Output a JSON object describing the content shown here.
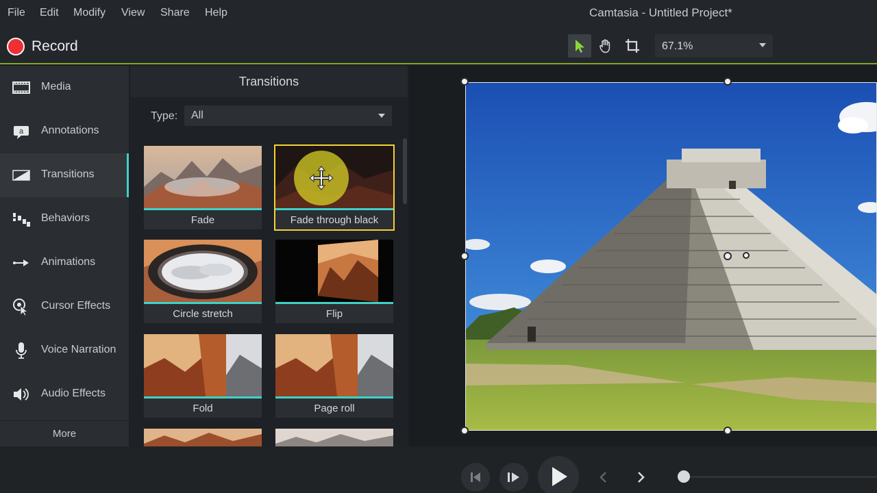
{
  "menu": [
    "File",
    "Edit",
    "Modify",
    "View",
    "Share",
    "Help"
  ],
  "window_title": "Camtasia - Untitled Project*",
  "toolbar": {
    "record_label": "Record",
    "zoom_value": "67.1%",
    "tools": [
      "select-tool",
      "pan-tool",
      "crop-tool"
    ]
  },
  "sidebar": {
    "items": [
      {
        "label": "Media",
        "icon": "film-icon"
      },
      {
        "label": "Annotations",
        "icon": "callout-icon"
      },
      {
        "label": "Transitions",
        "icon": "transition-icon",
        "active": true
      },
      {
        "label": "Behaviors",
        "icon": "behaviors-icon"
      },
      {
        "label": "Animations",
        "icon": "animation-arrow-icon"
      },
      {
        "label": "Cursor Effects",
        "icon": "cursor-effects-icon"
      },
      {
        "label": "Voice Narration",
        "icon": "microphone-icon"
      },
      {
        "label": "Audio Effects",
        "icon": "speaker-icon"
      }
    ],
    "more_label": "More"
  },
  "transitions": {
    "title": "Transitions",
    "type_label": "Type:",
    "type_value": "All",
    "items": [
      {
        "label": "Fade",
        "selected": false
      },
      {
        "label": "Fade through black",
        "selected": true
      },
      {
        "label": "Circle stretch",
        "selected": false
      },
      {
        "label": "Flip",
        "selected": false
      },
      {
        "label": "Fold",
        "selected": false
      },
      {
        "label": "Page roll",
        "selected": false
      }
    ]
  },
  "colors": {
    "accent_teal": "#3fd2c8",
    "selection_yellow": "#f3d336",
    "record_red": "#ee2f34",
    "toolbar_underline": "#7fa82c"
  },
  "playback": {
    "buttons": [
      "step-back-icon",
      "step-forward-icon",
      "play-icon",
      "previous-icon",
      "next-icon"
    ]
  }
}
